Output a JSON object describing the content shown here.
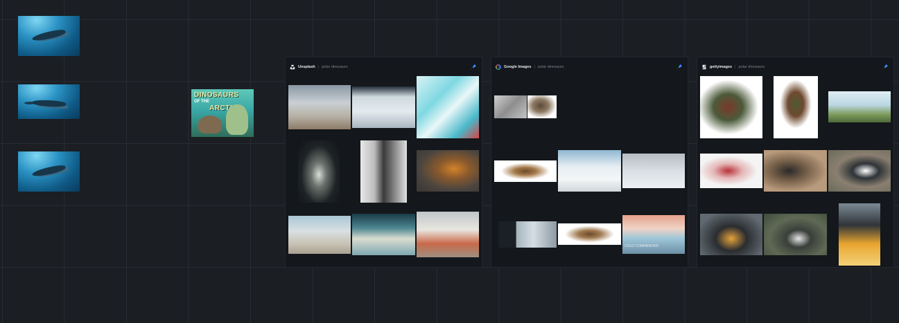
{
  "canvas": {
    "left_images": [
      {
        "icon": "shark-image"
      },
      {
        "icon": "shark-image"
      },
      {
        "icon": "shark-image"
      }
    ],
    "poster": {
      "line1": "DINOSAURS",
      "line2": "OF THE",
      "line3": "ARCTIC"
    }
  },
  "panels": [
    {
      "source": "Unsplash",
      "separator": "|",
      "query": "polar dinosaurs",
      "icon": "unsplash-icon",
      "pin_icon": "pin-icon"
    },
    {
      "source": "Google Images",
      "separator": "|",
      "query": "polar dinosaurs",
      "icon": "google-icon",
      "pin_icon": "pin-icon"
    },
    {
      "source": "gettyimages",
      "separator": "|",
      "query": "polar dinosaurs",
      "icon": "getty-icon",
      "pin_icon": "pin-icon"
    }
  ],
  "google_caption": "COLD COMPANIONS",
  "colors": {
    "canvas_bg": "#1b1e23",
    "panel_bg": "#14171b",
    "pin_accent": "#3f8cff"
  }
}
